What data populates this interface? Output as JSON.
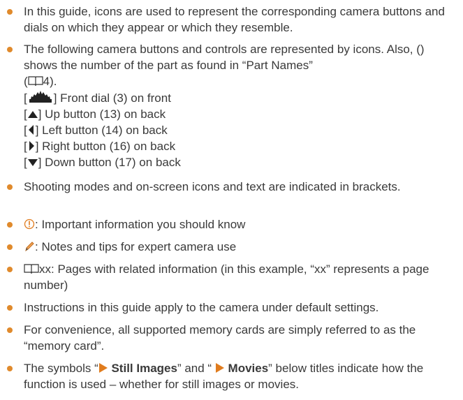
{
  "colors": {
    "bullet": "#e08a2c",
    "text": "#3a3a3a",
    "icon": "#333333",
    "arrow": "#e07c1e"
  },
  "items": {
    "b1": {
      "text": "In this guide, icons are used to represent the corresponding camera buttons and dials on which they appear or which they resemble."
    },
    "b2": {
      "text_a": "The following camera buttons and controls are represented by icons. Also, () shows the number of the part as found in “Part Names”",
      "ref_open": "(",
      "ref_page": "4",
      "ref_close": ").",
      "controls": [
        {
          "icon": "front-dial-icon",
          "text": "] Front dial (3) on front"
        },
        {
          "icon": "up-button-icon",
          "text": "] Up button (13) on back"
        },
        {
          "icon": "left-button-icon",
          "text": "] Left button (14) on back"
        },
        {
          "icon": "right-button-icon",
          "text": "] Right button (16) on back"
        },
        {
          "icon": "down-button-icon",
          "text": "] Down button (17) on back"
        }
      ],
      "bracket_open": "["
    },
    "b3": {
      "text": "Shooting modes and on-screen icons and text are indicated in brackets."
    },
    "b4": {
      "icon": "important-icon",
      "text": ": Important information you should know"
    },
    "b5": {
      "icon": "pencil-icon",
      "text": ": Notes and tips for expert camera use"
    },
    "b6": {
      "icon": "book-icon",
      "text": "xx: Pages with related information (in this example, “xx” represents a page number)"
    },
    "b7": {
      "text": "Instructions in this guide apply to the camera under default settings."
    },
    "b8": {
      "text": "For convenience, all supported memory cards are simply referred to as the “memory card”."
    },
    "b9": {
      "text_a": "The symbols “",
      "still": " Still Images",
      "text_b": "” and “ ",
      "movies": " Movies",
      "text_c": "” below titles indicate how the function is used – whether for still images or movies."
    }
  }
}
